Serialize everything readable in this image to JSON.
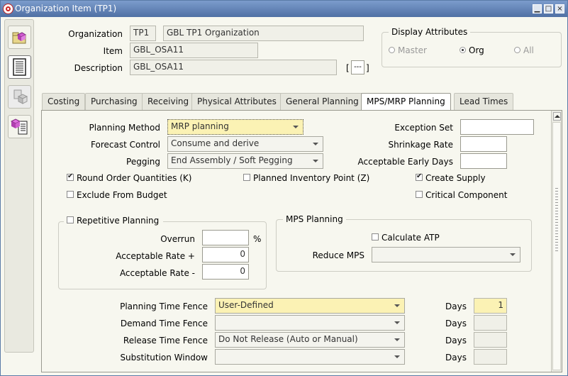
{
  "window": {
    "title": "Organization Item (TP1)",
    "controls": [
      "minimize-icon",
      "maximize-icon",
      "close-icon"
    ]
  },
  "toolbar": {
    "tools": [
      "folder-icon",
      "list-icon",
      "item-icon",
      "item-list-icon"
    ]
  },
  "header": {
    "organization_label": "Organization",
    "organization_code": "TP1",
    "organization_name": "GBL TP1 Organization",
    "item_label": "Item",
    "item_value": "GBL_OSA11",
    "description_label": "Description",
    "description_value": "GBL_OSA11",
    "flex_open": "[",
    "flex_button": "---",
    "flex_close": "]"
  },
  "display_attributes": {
    "title": "Display Attributes",
    "options": [
      {
        "label": "Master",
        "selected": false
      },
      {
        "label": "Org",
        "selected": true
      },
      {
        "label": "All",
        "selected": false
      }
    ]
  },
  "tabs": [
    {
      "label": "Costing",
      "active": false
    },
    {
      "label": "Purchasing",
      "active": false
    },
    {
      "label": "Receiving",
      "active": false
    },
    {
      "label": "Physical Attributes",
      "active": false
    },
    {
      "label": "General Planning",
      "active": false
    },
    {
      "label": "MPS/MRP Planning",
      "active": true
    },
    {
      "label": "Lead Times",
      "active": false
    }
  ],
  "planning": {
    "planning_method_label": "Planning Method",
    "planning_method_value": "MRP planning",
    "forecast_control_label": "Forecast Control",
    "forecast_control_value": "Consume and derive",
    "pegging_label": "Pegging",
    "pegging_value": "End Assembly / Soft Pegging",
    "exception_set_label": "Exception Set",
    "exception_set_value": "",
    "shrinkage_rate_label": "Shrinkage Rate",
    "shrinkage_rate_value": "",
    "early_days_label": "Acceptable Early Days",
    "early_days_value": ""
  },
  "checkboxes": {
    "round_order": {
      "label": "Round Order Quantities (K)",
      "checked": true
    },
    "planned_inventory": {
      "label": "Planned Inventory Point (Z)",
      "checked": false
    },
    "create_supply": {
      "label": "Create Supply",
      "checked": true
    },
    "exclude_budget": {
      "label": "Exclude From Budget",
      "checked": false
    },
    "critical_component": {
      "label": "Critical Component",
      "checked": false
    }
  },
  "repetitive": {
    "title": "Repetitive Planning",
    "checked": false,
    "overrun_label": "Overrun",
    "overrun_value": "",
    "overrun_unit": "%",
    "rate_plus_label": "Acceptable Rate +",
    "rate_plus_value": "0",
    "rate_minus_label": "Acceptable Rate -",
    "rate_minus_value": "0"
  },
  "mps": {
    "title": "MPS Planning",
    "calculate_atp_label": "Calculate ATP",
    "calculate_atp_checked": false,
    "reduce_mps_label": "Reduce MPS",
    "reduce_mps_value": ""
  },
  "fences": {
    "planning_label": "Planning Time Fence",
    "planning_value": "User-Defined",
    "planning_days": "1",
    "demand_label": "Demand Time Fence",
    "demand_value": "",
    "demand_days": "",
    "release_label": "Release Time Fence",
    "release_value": "Do Not Release (Auto or Manual)",
    "release_days": "",
    "substitution_label": "Substitution Window",
    "substitution_value": "",
    "substitution_days": "",
    "days_label": "Days"
  },
  "colors": {
    "titlebar": "#5d7fb3",
    "required_field": "#fbf2b4",
    "active_field": "#fce9a0",
    "window_bg": "#f7f7ef"
  }
}
